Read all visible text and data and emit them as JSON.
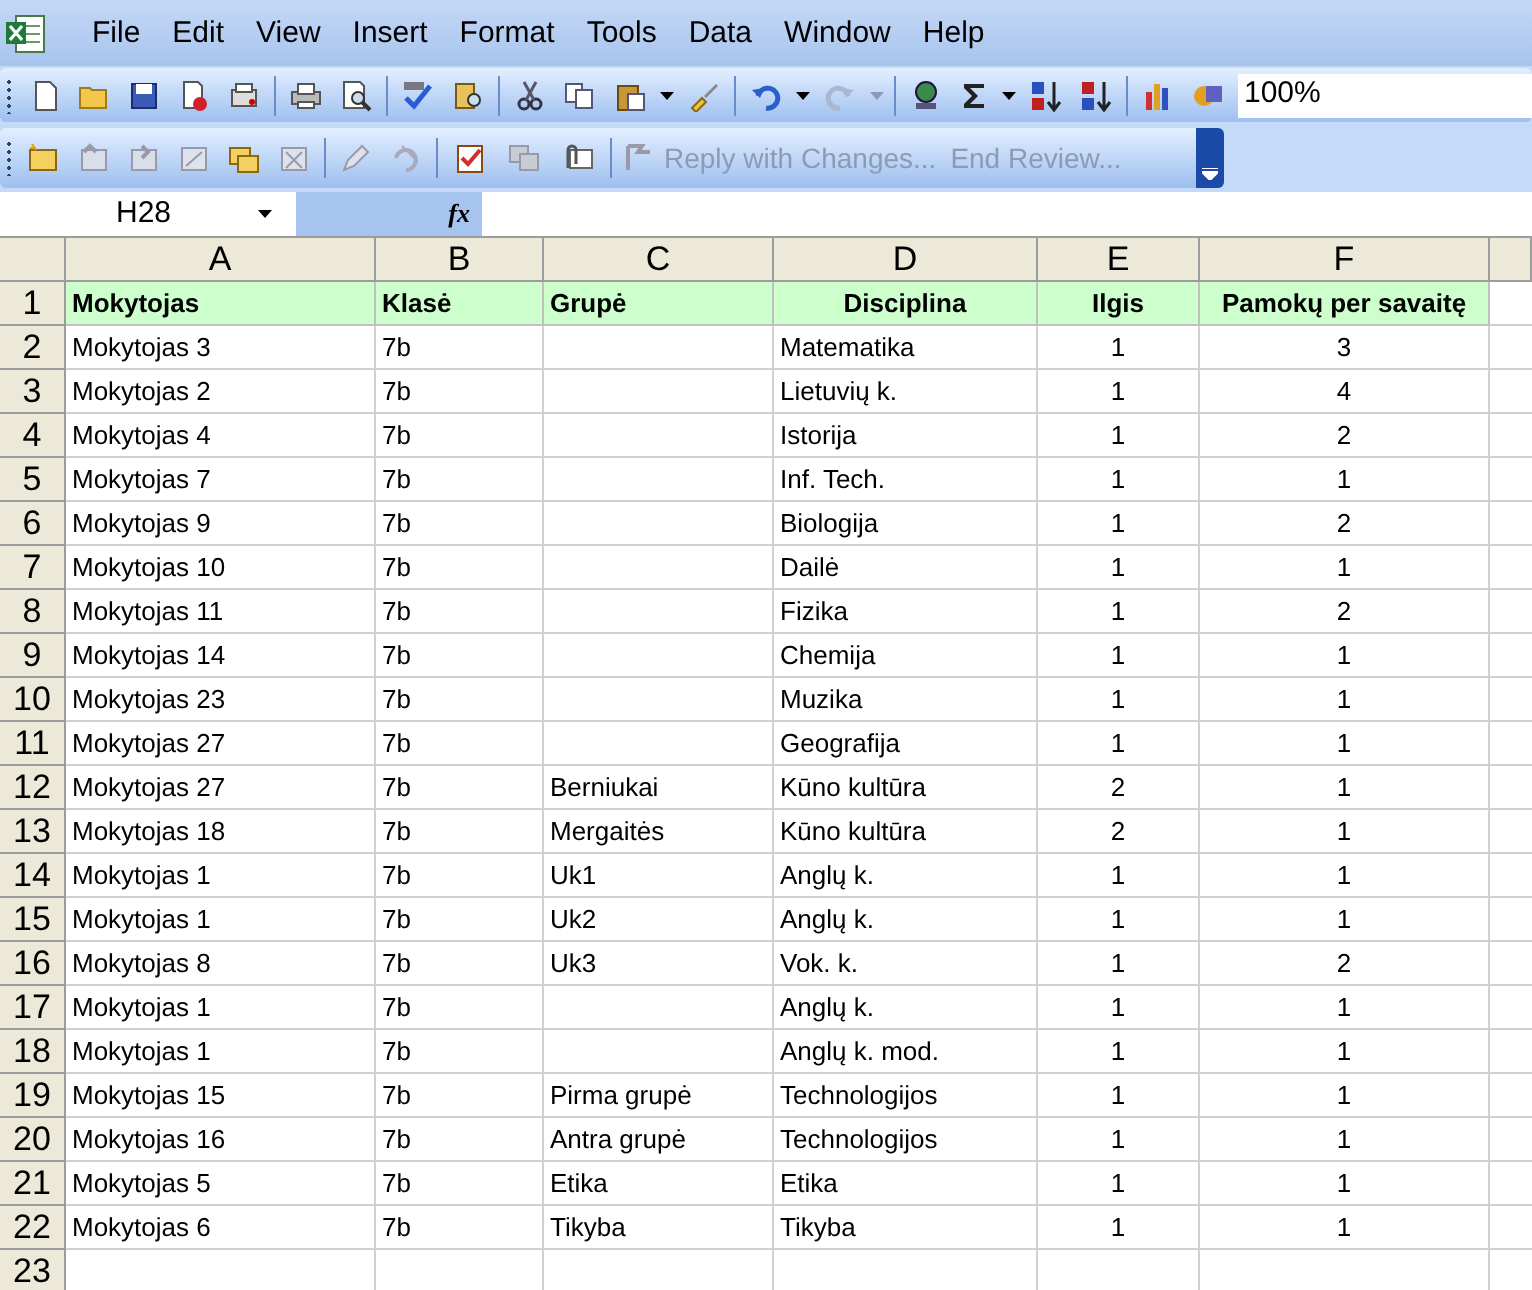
{
  "menu": [
    {
      "label": "File"
    },
    {
      "label": "Edit"
    },
    {
      "label": "View"
    },
    {
      "label": "Insert"
    },
    {
      "label": "Format"
    },
    {
      "label": "Tools"
    },
    {
      "label": "Data"
    },
    {
      "label": "Window"
    },
    {
      "label": "Help"
    }
  ],
  "standard_toolbar": {
    "zoom": "100%"
  },
  "reviewing_toolbar": {
    "buttons": [
      {
        "label": "Reply with Changes...",
        "disabled": true
      },
      {
        "label": "End Review...",
        "disabled": true
      }
    ]
  },
  "formula_bar": {
    "name_box": "H28",
    "function_label": "fx"
  },
  "sheet": {
    "columns": [
      "A",
      "B",
      "C",
      "D",
      "E",
      "F"
    ],
    "rows": [
      {
        "number": "1",
        "header": true,
        "cells": [
          "Mokytojas",
          "Klasė",
          "Grupė",
          "Disciplina",
          "Ilgis",
          "Pamokų per savaitę"
        ]
      },
      {
        "number": "2",
        "header": false,
        "cells": [
          "Mokytojas 3",
          "7b",
          null,
          "Matematika",
          "1",
          "3"
        ]
      },
      {
        "number": "3",
        "header": false,
        "cells": [
          "Mokytojas 2",
          "7b",
          null,
          "Lietuvių k.",
          "1",
          "4"
        ]
      },
      {
        "number": "4",
        "header": false,
        "cells": [
          "Mokytojas 4",
          "7b",
          null,
          "Istorija",
          "1",
          "2"
        ]
      },
      {
        "number": "5",
        "header": false,
        "cells": [
          "Mokytojas 7",
          "7b",
          null,
          "Inf. Tech.",
          "1",
          "1"
        ]
      },
      {
        "number": "6",
        "header": false,
        "cells": [
          "Mokytojas 9",
          "7b",
          null,
          "Biologija",
          "1",
          "2"
        ]
      },
      {
        "number": "7",
        "header": false,
        "cells": [
          "Mokytojas 10",
          "7b",
          null,
          "Dailė",
          "1",
          "1"
        ]
      },
      {
        "number": "8",
        "header": false,
        "cells": [
          "Mokytojas 11",
          "7b",
          null,
          "Fizika",
          "1",
          "2"
        ]
      },
      {
        "number": "9",
        "header": false,
        "cells": [
          "Mokytojas 14",
          "7b",
          null,
          "Chemija",
          "1",
          "1"
        ]
      },
      {
        "number": "10",
        "header": false,
        "cells": [
          "Mokytojas 23",
          "7b",
          null,
          "Muzika",
          "1",
          "1"
        ]
      },
      {
        "number": "11",
        "header": false,
        "cells": [
          "Mokytojas 27",
          "7b",
          null,
          "Geografija",
          "1",
          "1"
        ]
      },
      {
        "number": "12",
        "header": false,
        "cells": [
          "Mokytojas 27",
          "7b",
          "Berniukai",
          "Kūno kultūra",
          "2",
          "1"
        ]
      },
      {
        "number": "13",
        "header": false,
        "cells": [
          "Mokytojas 18",
          "7b",
          "Mergaitės",
          "Kūno kultūra",
          "2",
          "1"
        ]
      },
      {
        "number": "14",
        "header": false,
        "cells": [
          "Mokytojas 1",
          "7b",
          "Uk1",
          "Anglų k.",
          "1",
          "1"
        ]
      },
      {
        "number": "15",
        "header": false,
        "cells": [
          "Mokytojas 1",
          "7b",
          "Uk2",
          "Anglų k.",
          "1",
          "1"
        ]
      },
      {
        "number": "16",
        "header": false,
        "cells": [
          "Mokytojas 8",
          "7b",
          "Uk3",
          "Vok. k.",
          "1",
          "2"
        ]
      },
      {
        "number": "17",
        "header": false,
        "cells": [
          "Mokytojas 1",
          "7b",
          null,
          "Anglų k.",
          "1",
          "1"
        ]
      },
      {
        "number": "18",
        "header": false,
        "cells": [
          "Mokytojas 1",
          "7b",
          null,
          "Anglų k. mod.",
          "1",
          "1"
        ]
      },
      {
        "number": "19",
        "header": false,
        "cells": [
          "Mokytojas 15",
          "7b",
          "Pirma grupė",
          "Technologijos",
          "1",
          "1"
        ]
      },
      {
        "number": "20",
        "header": false,
        "cells": [
          "Mokytojas 16",
          "7b",
          "Antra grupė",
          "Technologijos",
          "1",
          "1"
        ]
      },
      {
        "number": "21",
        "header": false,
        "cells": [
          "Mokytojas 5",
          "7b",
          "Etika",
          "Etika",
          "1",
          "1"
        ]
      },
      {
        "number": "22",
        "header": false,
        "cells": [
          "Mokytojas 6",
          "7b",
          "Tikyba",
          "Tikyba",
          "1",
          "1"
        ]
      },
      {
        "number": "23",
        "header": false,
        "cells": [
          null,
          null,
          null,
          null,
          null,
          null
        ]
      }
    ]
  }
}
